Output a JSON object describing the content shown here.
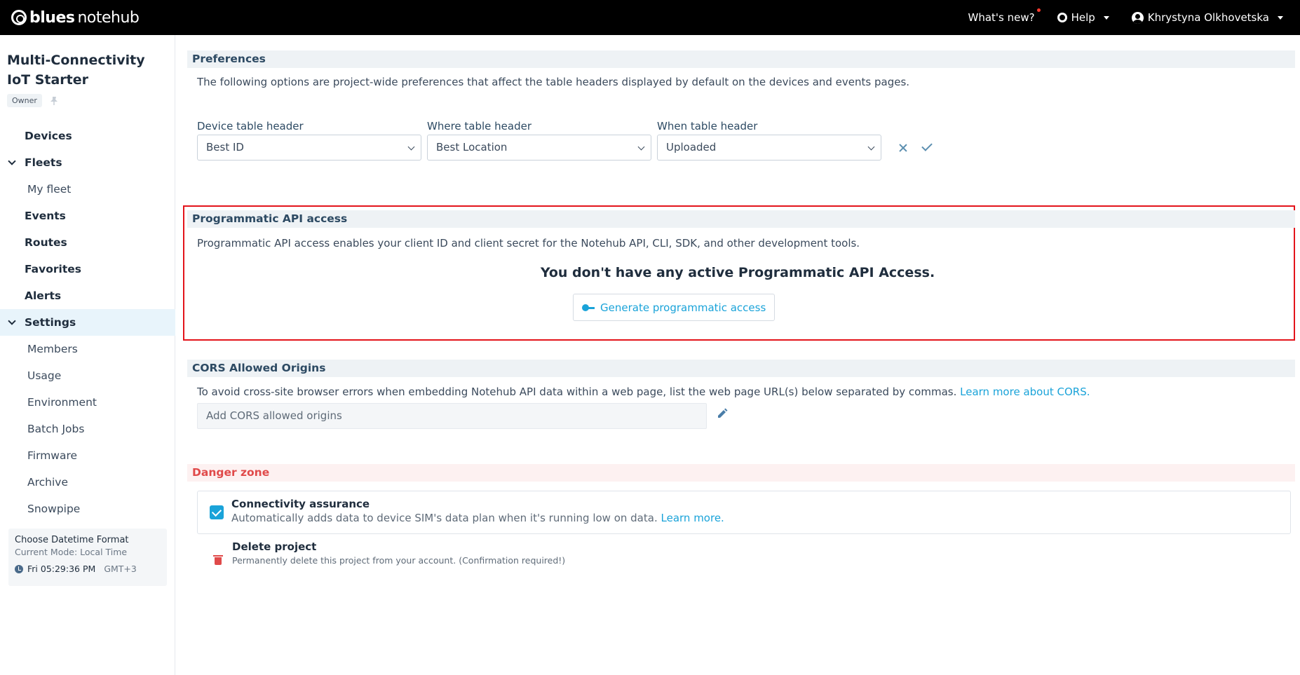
{
  "topbar": {
    "logo_brand": "blues",
    "logo_product": "notehub",
    "whats_new": "What's new?",
    "help": "Help",
    "user": "Khrystyna Olkhovetska"
  },
  "sidebar": {
    "project_title": "Multi-Connectivity IoT Starter",
    "owner_badge": "Owner",
    "items": [
      {
        "label": "Devices"
      },
      {
        "label": "Fleets"
      },
      {
        "label": "My fleet"
      },
      {
        "label": "Events"
      },
      {
        "label": "Routes"
      },
      {
        "label": "Favorites"
      },
      {
        "label": "Alerts"
      },
      {
        "label": "Settings"
      },
      {
        "label": "Members"
      },
      {
        "label": "Usage"
      },
      {
        "label": "Environment"
      },
      {
        "label": "Batch Jobs"
      },
      {
        "label": "Firmware"
      },
      {
        "label": "Archive"
      },
      {
        "label": "Snowpipe"
      }
    ],
    "datetime": {
      "title": "Choose Datetime Format",
      "mode": "Current Mode: Local Time",
      "time": "Fri 05:29:36 PM",
      "tz": "GMT+3"
    }
  },
  "preferences": {
    "header": "Preferences",
    "description": "The following options are project-wide preferences that affect the table headers displayed by default on the devices and events pages.",
    "device_label": "Device table header",
    "device_value": "Best ID",
    "where_label": "Where table header",
    "where_value": "Best Location",
    "when_label": "When table header",
    "when_value": "Uploaded"
  },
  "api_access": {
    "header": "Programmatic API access",
    "description": "Programmatic API access enables your client ID and client secret for the Notehub API, CLI, SDK, and other development tools.",
    "empty_title": "You don't have any active Programmatic API Access.",
    "button": "Generate programmatic access"
  },
  "cors": {
    "header": "CORS Allowed Origins",
    "description": "To avoid cross-site browser errors when embedding Notehub API data within a web page, list the web page URL(s) below separated by commas.",
    "link": "Learn more about CORS.",
    "placeholder": "Add CORS allowed origins"
  },
  "danger": {
    "header": "Danger zone",
    "assurance_title": "Connectivity assurance",
    "assurance_desc": "Automatically adds data to device SIM's data plan when it's running low on data.",
    "assurance_link": "Learn more.",
    "delete_title": "Delete project",
    "delete_desc": "Permanently delete this project from your account. (Confirmation required!)"
  },
  "colors": {
    "accent": "#1aa3d9",
    "danger": "#e04a4a",
    "highlight": "#e3141b",
    "topbar": "#000000"
  }
}
